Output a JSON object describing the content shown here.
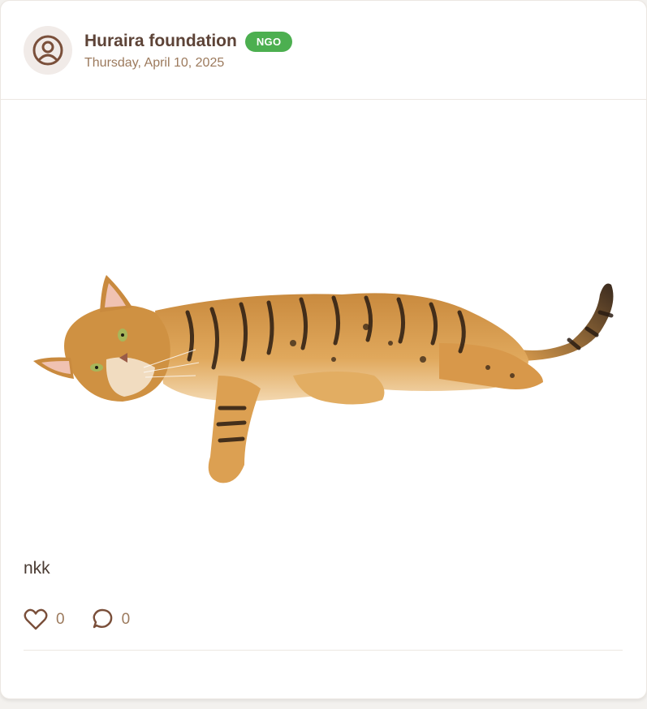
{
  "post": {
    "author": "Huraira foundation",
    "badge": "NGO",
    "date": "Thursday, April 10, 2025",
    "text": "nkk",
    "likes": "0",
    "comments": "0"
  },
  "icons": {
    "avatar": "user-circle-icon",
    "like": "heart-icon",
    "comment": "comment-bubble-icon"
  },
  "colors": {
    "badge": "#4caf50",
    "author": "#5d4337",
    "muted": "#9c7a5d",
    "icon": "#7a4f3a"
  }
}
